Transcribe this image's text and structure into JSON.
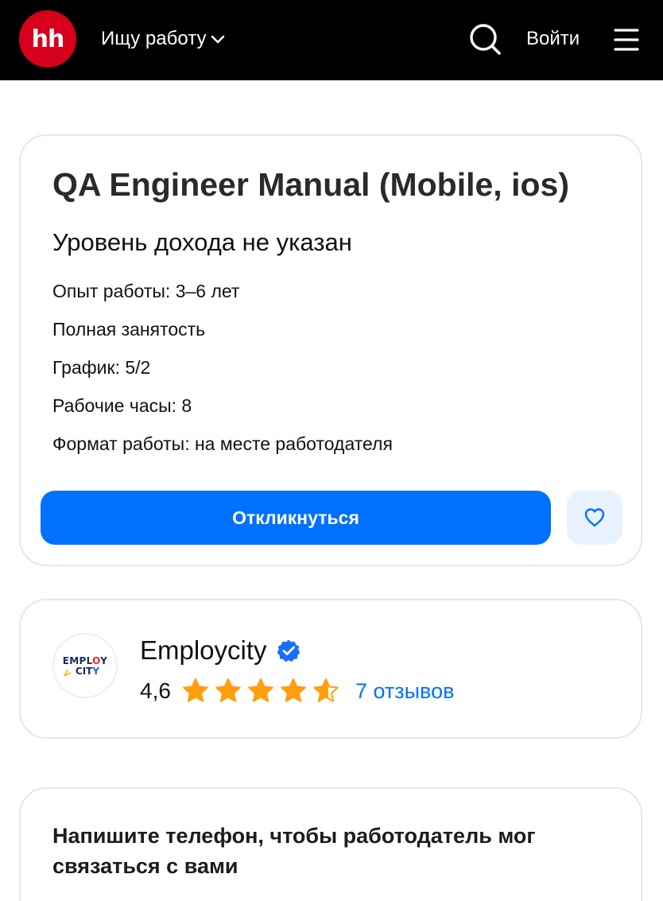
{
  "header": {
    "logo_text": "hh",
    "role_label": "Ищу работу",
    "login_label": "Войти",
    "brand_color": "#d6001c"
  },
  "vacancy": {
    "title": "QA Engineer Manual (Mobile, ios)",
    "salary": "Уровень дохода не указан",
    "details": [
      "Опыт работы: 3–6 лет",
      "Полная занятость",
      "График: 5/2",
      "Рабочие часы: 8",
      "Формат работы: на месте работодателя"
    ],
    "apply_label": "Откликнуться",
    "accent_color": "#0070ff"
  },
  "employer": {
    "logo_line1_a": "EMPL",
    "logo_line1_b": "O",
    "logo_line1_c": "Y",
    "logo_line2_a": "CIT",
    "logo_line2_b": "Y",
    "name": "Employcity",
    "verified": true,
    "rating": "4,6",
    "stars_value": 4.6,
    "stars_max": 5,
    "reviews_label": "7 отзывов",
    "star_color": "#ff9e0f"
  },
  "phone_prompt": {
    "heading": "Напишите телефон, чтобы работодатель мог связаться с вами"
  },
  "icons": [
    "chevron-down-icon",
    "search-icon",
    "menu-icon",
    "heart-icon",
    "verified-icon",
    "star-icon"
  ]
}
